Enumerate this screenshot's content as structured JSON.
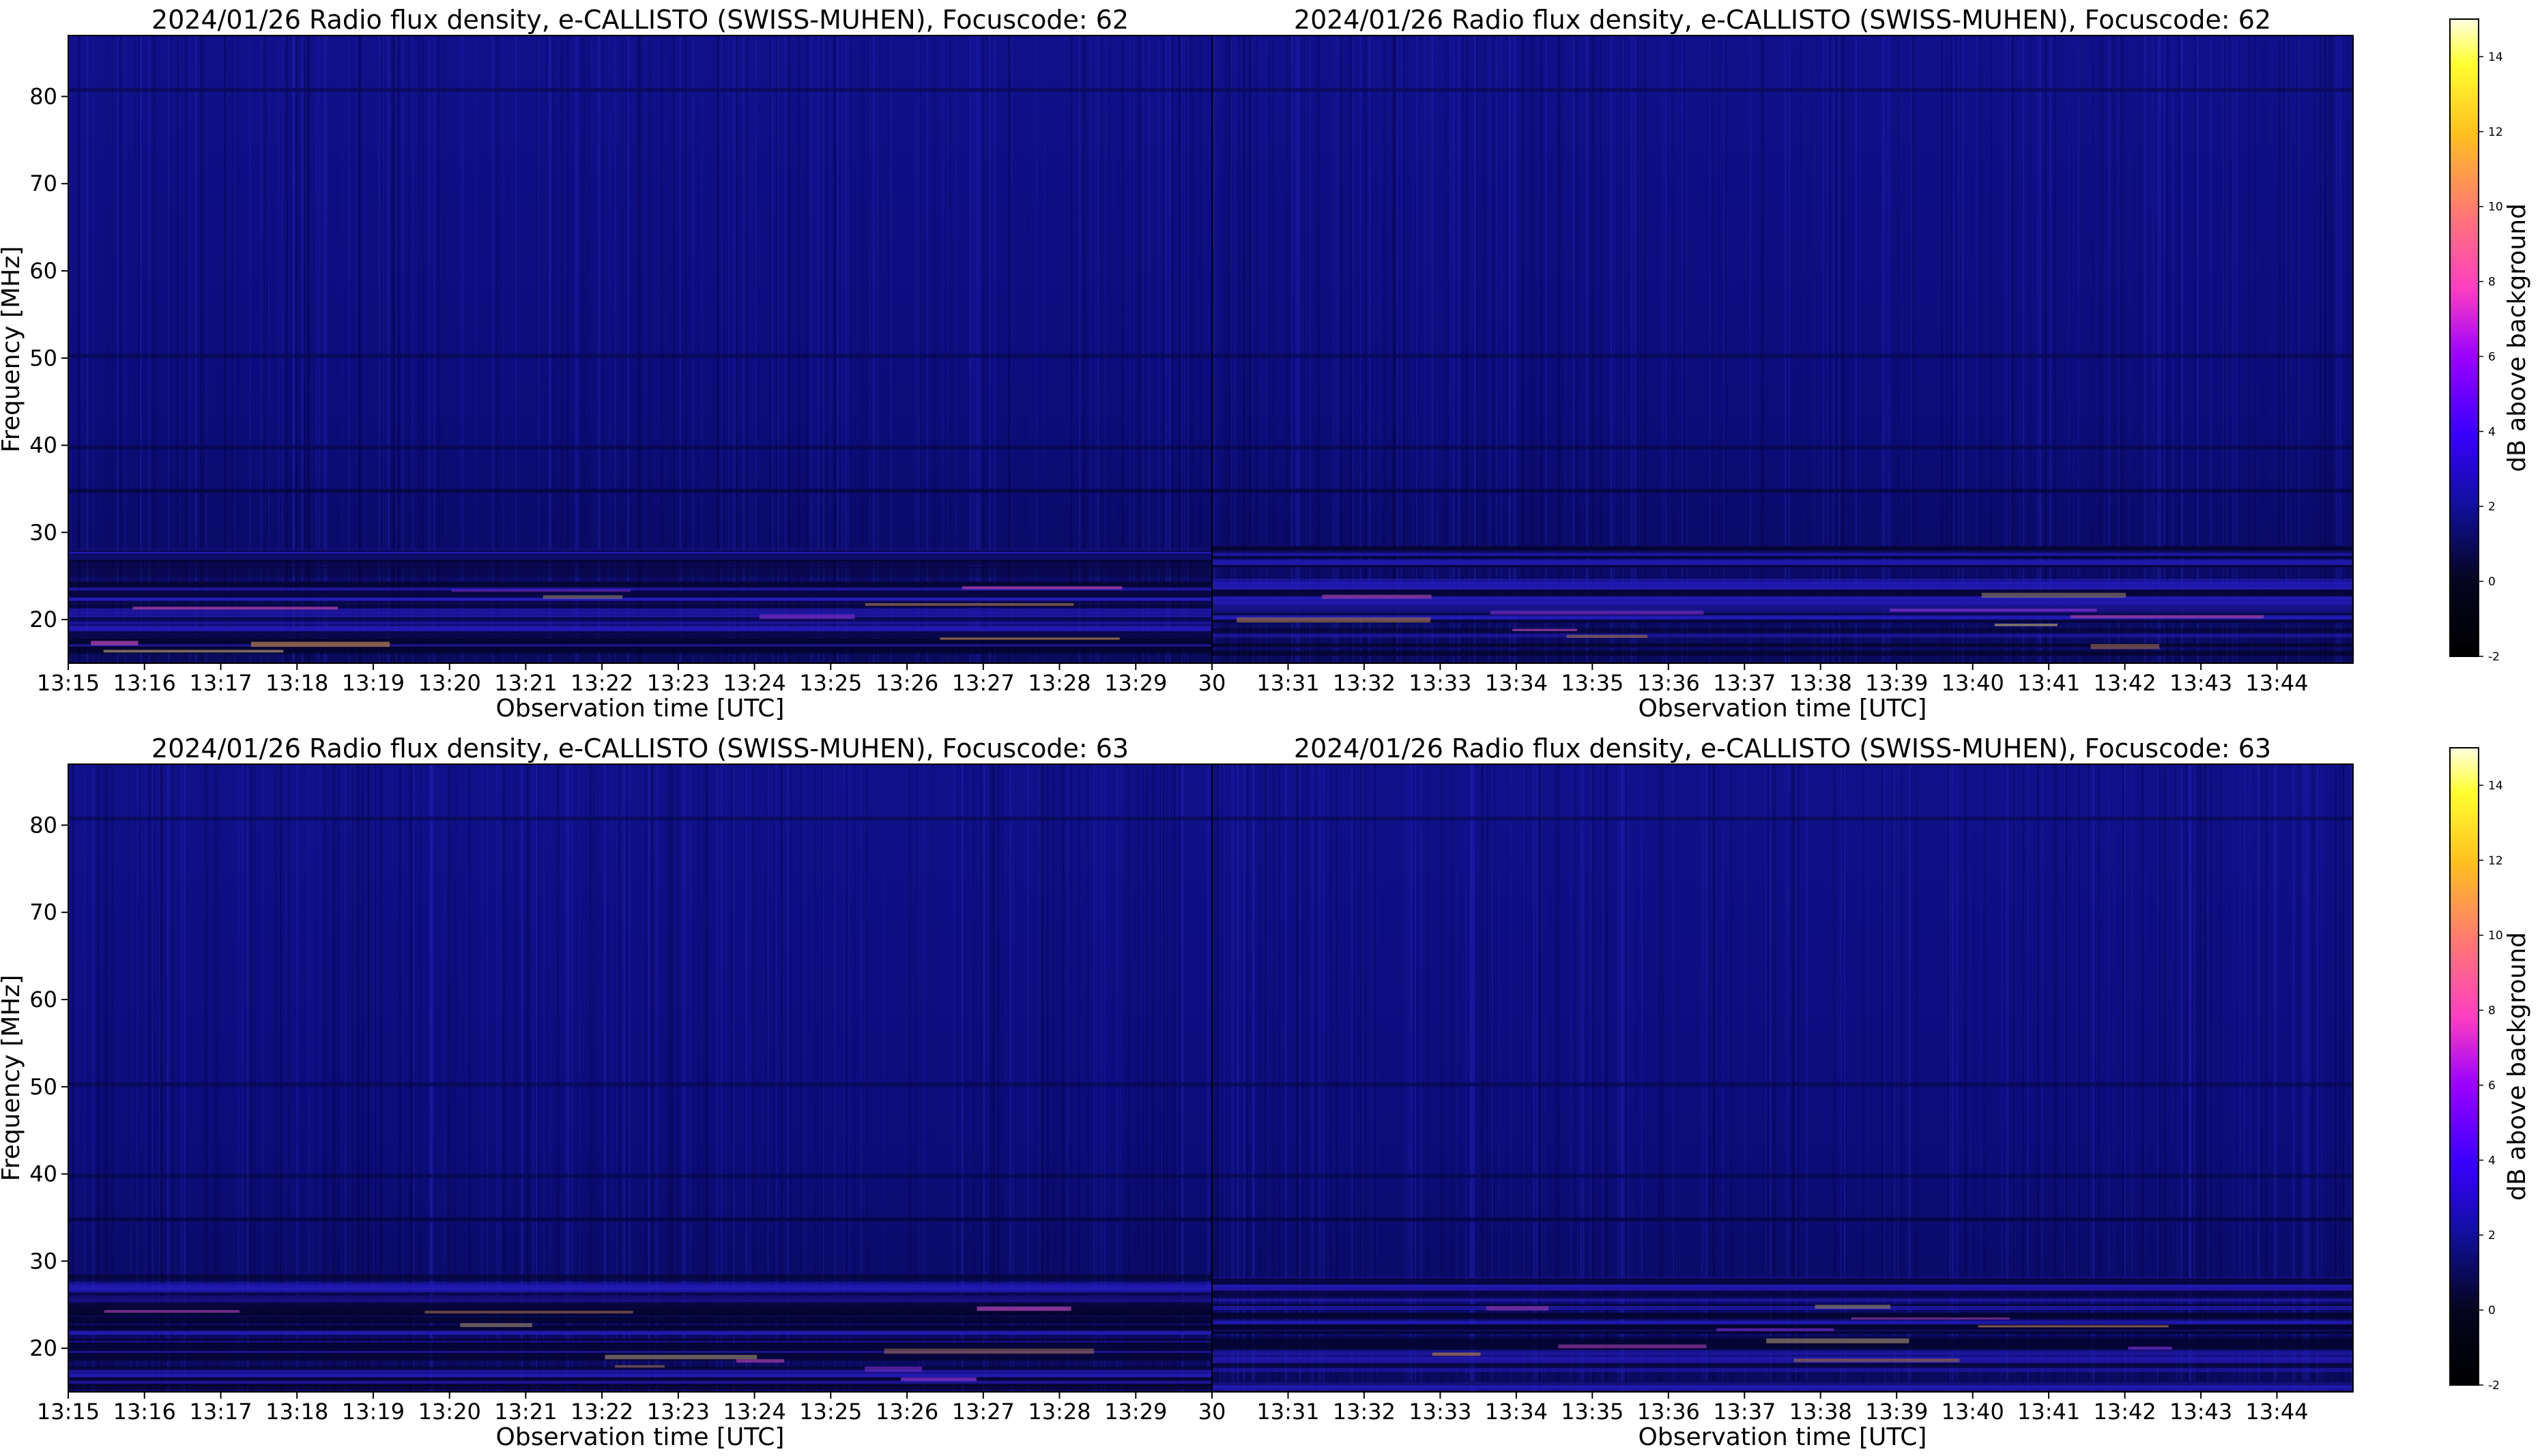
{
  "colors": {
    "background": "#ffffff",
    "axis": "#000000"
  },
  "chart_data": [
    {
      "type": "heatmap",
      "title": "2024/01/26  Radio flux density, e-CALLISTO (SWISS-MUHEN), Focuscode: 62",
      "xlabel": "Observation time [UTC]",
      "ylabel": "Frequency [MHz]",
      "xticks": [
        "13:15",
        "13:16",
        "13:17",
        "13:18",
        "13:19",
        "13:20",
        "13:21",
        "13:22",
        "13:23",
        "13:24",
        "13:25",
        "13:26",
        "13:27",
        "13:28",
        "13:29"
      ],
      "yticks": [
        20,
        30,
        40,
        50,
        60,
        70,
        80
      ],
      "ylim": [
        15,
        87
      ]
    },
    {
      "type": "heatmap",
      "title": "2024/01/26  Radio flux density, e-CALLISTO (SWISS-MUHEN), Focuscode: 62",
      "xlabel": "Observation time [UTC]",
      "ylabel": "",
      "xticks": [
        "30",
        "13:31",
        "13:32",
        "13:33",
        "13:34",
        "13:35",
        "13:36",
        "13:37",
        "13:38",
        "13:39",
        "13:40",
        "13:41",
        "13:42",
        "13:43",
        "13:44"
      ],
      "yticks": [],
      "ylim": [
        15,
        87
      ],
      "colorbar": {
        "label": "dB above background",
        "ticks": [
          -2,
          0,
          2,
          4,
          6,
          8,
          10,
          12,
          14
        ],
        "range": [
          -2,
          15
        ]
      }
    },
    {
      "type": "heatmap",
      "title": "2024/01/26  Radio flux density, e-CALLISTO (SWISS-MUHEN), Focuscode: 63",
      "xlabel": "Observation time [UTC]",
      "ylabel": "Frequency [MHz]",
      "xticks": [
        "13:15",
        "13:16",
        "13:17",
        "13:18",
        "13:19",
        "13:20",
        "13:21",
        "13:22",
        "13:23",
        "13:24",
        "13:25",
        "13:26",
        "13:27",
        "13:28",
        "13:29"
      ],
      "yticks": [
        20,
        30,
        40,
        50,
        60,
        70,
        80
      ],
      "ylim": [
        15,
        87
      ]
    },
    {
      "type": "heatmap",
      "title": "2024/01/26  Radio flux density, e-CALLISTO (SWISS-MUHEN), Focuscode: 63",
      "xlabel": "Observation time [UTC]",
      "ylabel": "",
      "xticks": [
        "30",
        "13:31",
        "13:32",
        "13:33",
        "13:34",
        "13:35",
        "13:36",
        "13:37",
        "13:38",
        "13:39",
        "13:40",
        "13:41",
        "13:42",
        "13:43",
        "13:44"
      ],
      "yticks": [],
      "ylim": [
        15,
        87
      ],
      "colorbar": {
        "label": "dB above background",
        "ticks": [
          -2,
          0,
          2,
          4,
          6,
          8,
          10,
          12,
          14
        ],
        "range": [
          -2,
          15
        ]
      }
    }
  ]
}
